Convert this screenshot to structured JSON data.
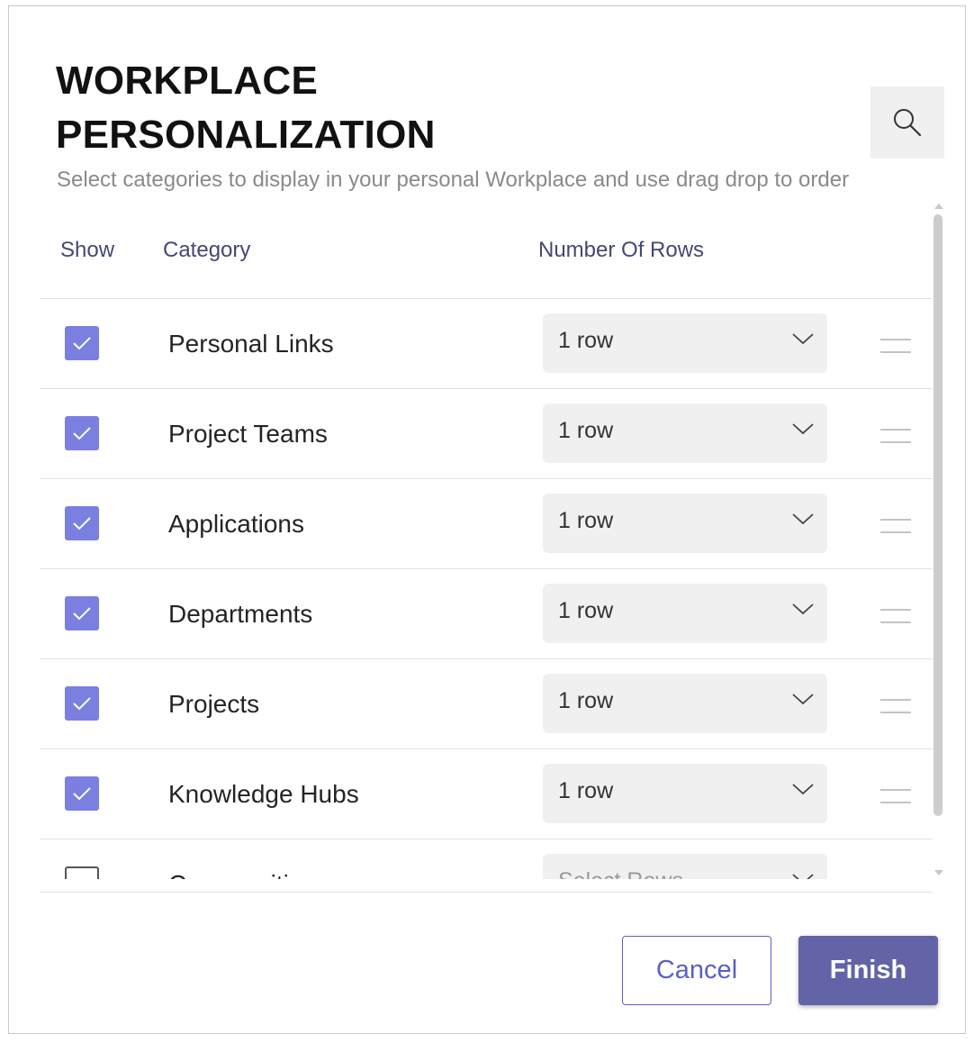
{
  "dialog": {
    "title_line1": "WORKPLACE",
    "title_line2": "PERSONALIZATION",
    "subtitle": "Select categories to display in your personal Workplace and use drag drop to order",
    "search_icon": "search-icon"
  },
  "table": {
    "headers": {
      "show": "Show",
      "category": "Category",
      "rows": "Number Of Rows"
    },
    "rows": [
      {
        "checked": true,
        "category": "Personal Links",
        "rows_value": "1 row"
      },
      {
        "checked": true,
        "category": "Project Teams",
        "rows_value": "1 row"
      },
      {
        "checked": true,
        "category": "Applications",
        "rows_value": "1 row"
      },
      {
        "checked": true,
        "category": "Departments",
        "rows_value": "1 row"
      },
      {
        "checked": true,
        "category": "Projects",
        "rows_value": "1 row"
      },
      {
        "checked": true,
        "category": "Knowledge Hubs",
        "rows_value": "1 row"
      },
      {
        "checked": false,
        "category": "Communities",
        "rows_value": "Select Rows"
      }
    ]
  },
  "footer": {
    "cancel_label": "Cancel",
    "finish_label": "Finish"
  },
  "colors": {
    "accent": "#6264a7",
    "checkbox": "#7b7fe0",
    "header_text": "#464775"
  }
}
